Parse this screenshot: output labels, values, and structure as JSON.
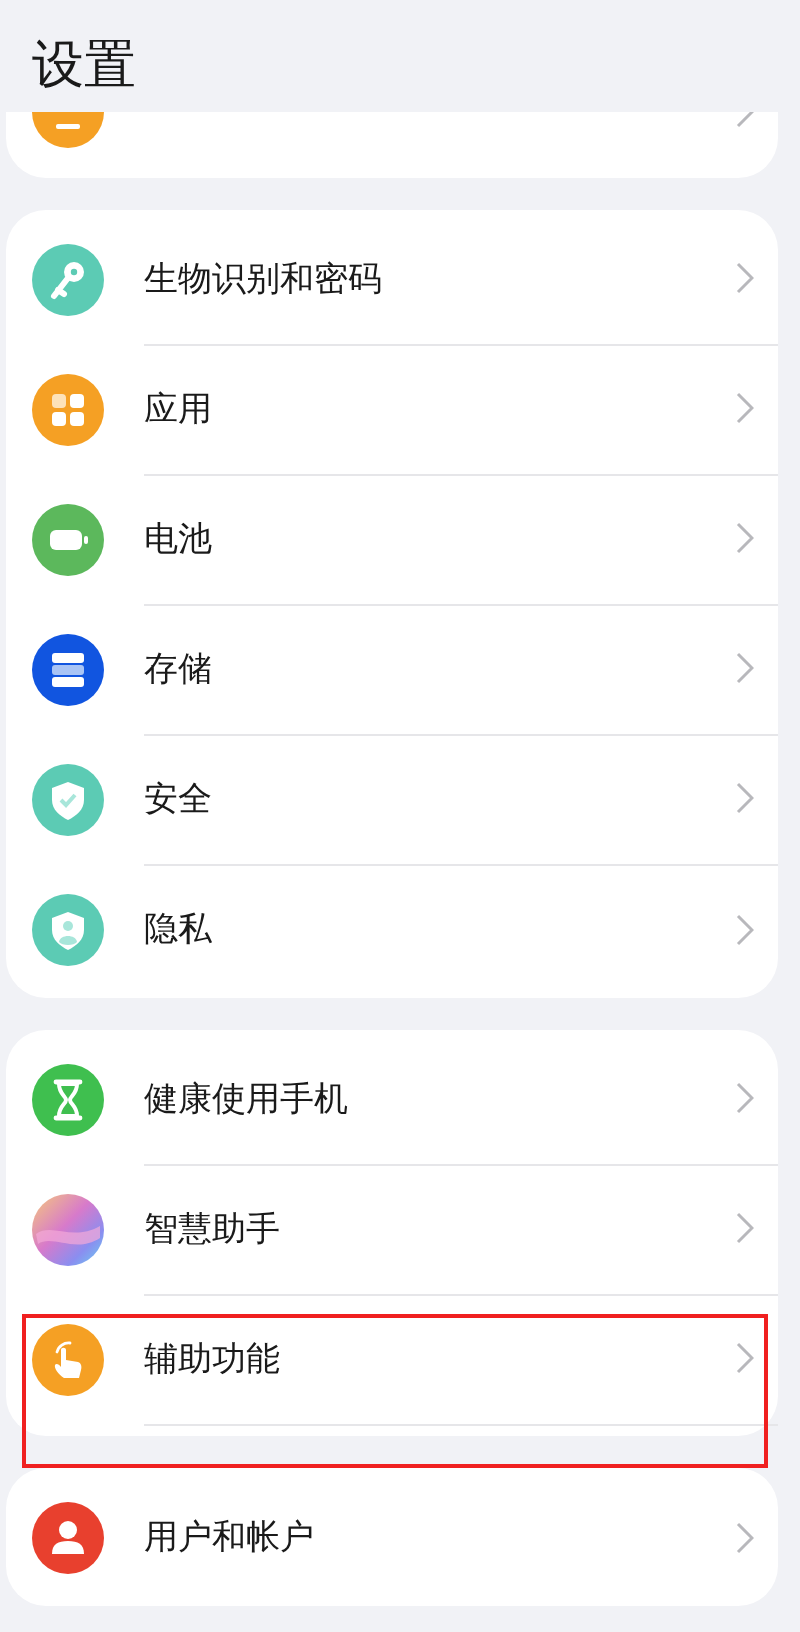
{
  "title": "设置",
  "groups": [
    {
      "clipped": true,
      "items": [
        {
          "kind": "app",
          "color": "#f5a024",
          "highlighted": false
        }
      ]
    },
    {
      "clipped": false,
      "items": [
        {
          "kind": "key",
          "color": "#5ccbb4",
          "label": "生物识别和密码",
          "highlighted": false
        },
        {
          "kind": "apps",
          "color": "#f5a024",
          "label": "应用",
          "highlighted": false
        },
        {
          "kind": "battery",
          "color": "#5cb85c",
          "label": "电池",
          "highlighted": false
        },
        {
          "kind": "storage",
          "color": "#1155e0",
          "label": "存储",
          "highlighted": false
        },
        {
          "kind": "shield",
          "color": "#5ccbb4",
          "label": "安全",
          "highlighted": false
        },
        {
          "kind": "privacy",
          "color": "#5ccbb4",
          "label": "隐私",
          "highlighted": false
        }
      ]
    },
    {
      "clipped": false,
      "items": [
        {
          "kind": "hourglass",
          "color": "#3fbf4f",
          "label": "健康使用手机",
          "highlighted": false
        },
        {
          "kind": "assistant",
          "label": "智慧助手",
          "highlighted": false
        },
        {
          "kind": "hand",
          "color": "#f5a024",
          "label": "辅助功能",
          "highlighted": true
        }
      ]
    },
    {
      "clipped": false,
      "items": [
        {
          "kind": "user",
          "color": "#e8402e",
          "label": "用户和帐户",
          "highlighted": false
        }
      ]
    }
  ]
}
